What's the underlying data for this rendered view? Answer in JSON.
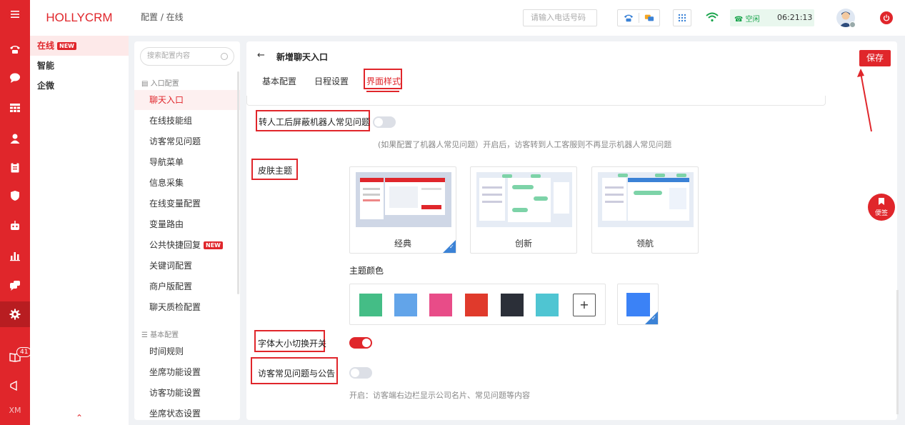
{
  "brand": "HOLLYCRM",
  "rail": {
    "icons": [
      "phone-icon",
      "chat-icon",
      "grid-icon",
      "user-icon",
      "clipboard-icon",
      "shield-icon",
      "robot-icon",
      "bar-chart-icon",
      "message-icon",
      "gear-icon",
      "book-icon",
      "megaphone-icon"
    ],
    "book_badge": "41",
    "bottom_text": "XM"
  },
  "categories": [
    {
      "label": "在线",
      "badge": "NEW"
    },
    {
      "label": "智能"
    },
    {
      "label": "企微"
    }
  ],
  "breadcrumb": "配置 / 在线",
  "header": {
    "phone_placeholder": "请输入电话号码",
    "status": "空闲",
    "time": "06:21:13"
  },
  "menu": {
    "search_placeholder": "搜索配置内容",
    "group1": "入口配置",
    "items1": [
      "聊天入口",
      "在线技能组",
      "访客常见问题",
      "导航菜单",
      "信息采集",
      "在线变量配置",
      "变量路由",
      "公共快捷回复",
      "关键词配置",
      "商户版配置",
      "聊天质检配置"
    ],
    "new_badge": "NEW",
    "group2": "基本配置",
    "items2": [
      "时间规则",
      "坐席功能设置",
      "访客功能设置",
      "坐席状态设置"
    ]
  },
  "page": {
    "back": "←",
    "title": "新增聊天入口",
    "tabs": [
      "基本配置",
      "日程设置",
      "界面样式"
    ],
    "save": "保存",
    "block_robot": {
      "label": "转人工后屏蔽机器人常见问题",
      "hint": "(如果配置了机器人常见问题）开启后，访客转到人工客服则不再显示机器人常见问题",
      "on": false
    },
    "skin_label": "皮肤主题",
    "themes": [
      "经典",
      "创新",
      "领航"
    ],
    "selected_theme": "经典",
    "color_label": "主题颜色",
    "colors": [
      "#44bd86",
      "#62a4e9",
      "#e84c88",
      "#e03a2c",
      "#2b2f38",
      "#4fc5d2"
    ],
    "selected_color": "#3b82f6",
    "plus": "+",
    "font_switch": {
      "label": "字体大小切换开关",
      "on": true
    },
    "visitor_faq": {
      "label": "访客常见问题与公告",
      "hint": "开启：访客端右边栏显示公司名片、常见问题等内容",
      "on": false
    }
  },
  "note_button": "便签"
}
